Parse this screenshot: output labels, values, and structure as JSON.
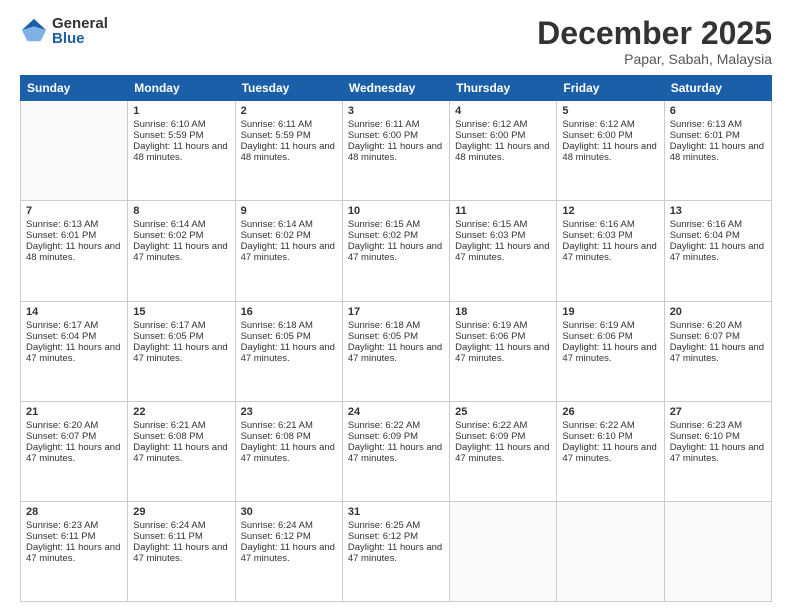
{
  "logo": {
    "general": "General",
    "blue": "Blue"
  },
  "header": {
    "month": "December 2025",
    "location": "Papar, Sabah, Malaysia"
  },
  "days": [
    "Sunday",
    "Monday",
    "Tuesday",
    "Wednesday",
    "Thursday",
    "Friday",
    "Saturday"
  ],
  "weeks": [
    [
      {
        "day": "",
        "sunrise": "",
        "sunset": "",
        "daylight": ""
      },
      {
        "day": "1",
        "sunrise": "Sunrise: 6:10 AM",
        "sunset": "Sunset: 5:59 PM",
        "daylight": "Daylight: 11 hours and 48 minutes."
      },
      {
        "day": "2",
        "sunrise": "Sunrise: 6:11 AM",
        "sunset": "Sunset: 5:59 PM",
        "daylight": "Daylight: 11 hours and 48 minutes."
      },
      {
        "day": "3",
        "sunrise": "Sunrise: 6:11 AM",
        "sunset": "Sunset: 6:00 PM",
        "daylight": "Daylight: 11 hours and 48 minutes."
      },
      {
        "day": "4",
        "sunrise": "Sunrise: 6:12 AM",
        "sunset": "Sunset: 6:00 PM",
        "daylight": "Daylight: 11 hours and 48 minutes."
      },
      {
        "day": "5",
        "sunrise": "Sunrise: 6:12 AM",
        "sunset": "Sunset: 6:00 PM",
        "daylight": "Daylight: 11 hours and 48 minutes."
      },
      {
        "day": "6",
        "sunrise": "Sunrise: 6:13 AM",
        "sunset": "Sunset: 6:01 PM",
        "daylight": "Daylight: 11 hours and 48 minutes."
      }
    ],
    [
      {
        "day": "7",
        "sunrise": "Sunrise: 6:13 AM",
        "sunset": "Sunset: 6:01 PM",
        "daylight": "Daylight: 11 hours and 48 minutes."
      },
      {
        "day": "8",
        "sunrise": "Sunrise: 6:14 AM",
        "sunset": "Sunset: 6:02 PM",
        "daylight": "Daylight: 11 hours and 47 minutes."
      },
      {
        "day": "9",
        "sunrise": "Sunrise: 6:14 AM",
        "sunset": "Sunset: 6:02 PM",
        "daylight": "Daylight: 11 hours and 47 minutes."
      },
      {
        "day": "10",
        "sunrise": "Sunrise: 6:15 AM",
        "sunset": "Sunset: 6:02 PM",
        "daylight": "Daylight: 11 hours and 47 minutes."
      },
      {
        "day": "11",
        "sunrise": "Sunrise: 6:15 AM",
        "sunset": "Sunset: 6:03 PM",
        "daylight": "Daylight: 11 hours and 47 minutes."
      },
      {
        "day": "12",
        "sunrise": "Sunrise: 6:16 AM",
        "sunset": "Sunset: 6:03 PM",
        "daylight": "Daylight: 11 hours and 47 minutes."
      },
      {
        "day": "13",
        "sunrise": "Sunrise: 6:16 AM",
        "sunset": "Sunset: 6:04 PM",
        "daylight": "Daylight: 11 hours and 47 minutes."
      }
    ],
    [
      {
        "day": "14",
        "sunrise": "Sunrise: 6:17 AM",
        "sunset": "Sunset: 6:04 PM",
        "daylight": "Daylight: 11 hours and 47 minutes."
      },
      {
        "day": "15",
        "sunrise": "Sunrise: 6:17 AM",
        "sunset": "Sunset: 6:05 PM",
        "daylight": "Daylight: 11 hours and 47 minutes."
      },
      {
        "day": "16",
        "sunrise": "Sunrise: 6:18 AM",
        "sunset": "Sunset: 6:05 PM",
        "daylight": "Daylight: 11 hours and 47 minutes."
      },
      {
        "day": "17",
        "sunrise": "Sunrise: 6:18 AM",
        "sunset": "Sunset: 6:05 PM",
        "daylight": "Daylight: 11 hours and 47 minutes."
      },
      {
        "day": "18",
        "sunrise": "Sunrise: 6:19 AM",
        "sunset": "Sunset: 6:06 PM",
        "daylight": "Daylight: 11 hours and 47 minutes."
      },
      {
        "day": "19",
        "sunrise": "Sunrise: 6:19 AM",
        "sunset": "Sunset: 6:06 PM",
        "daylight": "Daylight: 11 hours and 47 minutes."
      },
      {
        "day": "20",
        "sunrise": "Sunrise: 6:20 AM",
        "sunset": "Sunset: 6:07 PM",
        "daylight": "Daylight: 11 hours and 47 minutes."
      }
    ],
    [
      {
        "day": "21",
        "sunrise": "Sunrise: 6:20 AM",
        "sunset": "Sunset: 6:07 PM",
        "daylight": "Daylight: 11 hours and 47 minutes."
      },
      {
        "day": "22",
        "sunrise": "Sunrise: 6:21 AM",
        "sunset": "Sunset: 6:08 PM",
        "daylight": "Daylight: 11 hours and 47 minutes."
      },
      {
        "day": "23",
        "sunrise": "Sunrise: 6:21 AM",
        "sunset": "Sunset: 6:08 PM",
        "daylight": "Daylight: 11 hours and 47 minutes."
      },
      {
        "day": "24",
        "sunrise": "Sunrise: 6:22 AM",
        "sunset": "Sunset: 6:09 PM",
        "daylight": "Daylight: 11 hours and 47 minutes."
      },
      {
        "day": "25",
        "sunrise": "Sunrise: 6:22 AM",
        "sunset": "Sunset: 6:09 PM",
        "daylight": "Daylight: 11 hours and 47 minutes."
      },
      {
        "day": "26",
        "sunrise": "Sunrise: 6:22 AM",
        "sunset": "Sunset: 6:10 PM",
        "daylight": "Daylight: 11 hours and 47 minutes."
      },
      {
        "day": "27",
        "sunrise": "Sunrise: 6:23 AM",
        "sunset": "Sunset: 6:10 PM",
        "daylight": "Daylight: 11 hours and 47 minutes."
      }
    ],
    [
      {
        "day": "28",
        "sunrise": "Sunrise: 6:23 AM",
        "sunset": "Sunset: 6:11 PM",
        "daylight": "Daylight: 11 hours and 47 minutes."
      },
      {
        "day": "29",
        "sunrise": "Sunrise: 6:24 AM",
        "sunset": "Sunset: 6:11 PM",
        "daylight": "Daylight: 11 hours and 47 minutes."
      },
      {
        "day": "30",
        "sunrise": "Sunrise: 6:24 AM",
        "sunset": "Sunset: 6:12 PM",
        "daylight": "Daylight: 11 hours and 47 minutes."
      },
      {
        "day": "31",
        "sunrise": "Sunrise: 6:25 AM",
        "sunset": "Sunset: 6:12 PM",
        "daylight": "Daylight: 11 hours and 47 minutes."
      },
      {
        "day": "",
        "sunrise": "",
        "sunset": "",
        "daylight": ""
      },
      {
        "day": "",
        "sunrise": "",
        "sunset": "",
        "daylight": ""
      },
      {
        "day": "",
        "sunrise": "",
        "sunset": "",
        "daylight": ""
      }
    ]
  ]
}
